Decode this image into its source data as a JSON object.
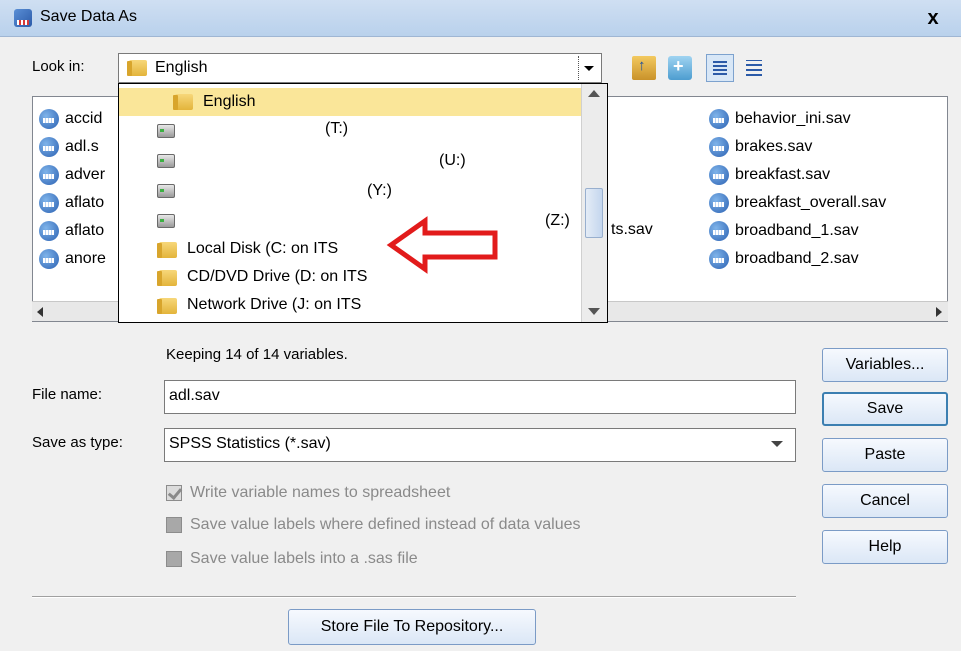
{
  "window": {
    "title": "Save Data As",
    "close_glyph": "x"
  },
  "look_in": {
    "label": "Look in:",
    "value": "English"
  },
  "toolbar": {
    "up": "up-folder-icon",
    "new_folder": "new-folder-icon",
    "list_view": "list-view-icon",
    "details_view": "details-view-icon"
  },
  "files": {
    "left": [
      "accid",
      "adl.s",
      "adver",
      "aflato",
      "aflato",
      "anore"
    ],
    "middle": [
      "ts.sav"
    ],
    "right": [
      "behavior_ini.sav",
      "brakes.sav",
      "breakfast.sav",
      "breakfast_overall.sav",
      "broadband_1.sav",
      "broadband_2.sav"
    ]
  },
  "dropdown": {
    "selected": "English",
    "drives": [
      {
        "label": "(T:)"
      },
      {
        "label": "(U:)"
      },
      {
        "label": "(Y:)"
      },
      {
        "label": "(Z:)"
      }
    ],
    "locals": [
      "Local Disk (C: on ITS",
      "CD/DVD Drive (D: on ITS",
      "Network Drive (J: on ITS"
    ]
  },
  "keeping": "Keeping 14 of 14 variables.",
  "file_name": {
    "label": "File name:",
    "value": "adl.sav"
  },
  "save_type": {
    "label": "Save as type:",
    "value": "SPSS Statistics (*.sav)"
  },
  "options": [
    {
      "label": "Write variable names to spreadsheet",
      "checked": true
    },
    {
      "label": "Save value labels where defined instead of data values",
      "checked": false
    },
    {
      "label": "Save value labels into a .sas file",
      "checked": false
    }
  ],
  "buttons": {
    "variables": "Variables...",
    "save": "Save",
    "paste": "Paste",
    "cancel": "Cancel",
    "help": "Help",
    "store": "Store File To Repository..."
  },
  "colors": {
    "selection": "#fae699",
    "annotation_arrow": "#e21b1b",
    "button_border": "#7b9bc6"
  }
}
